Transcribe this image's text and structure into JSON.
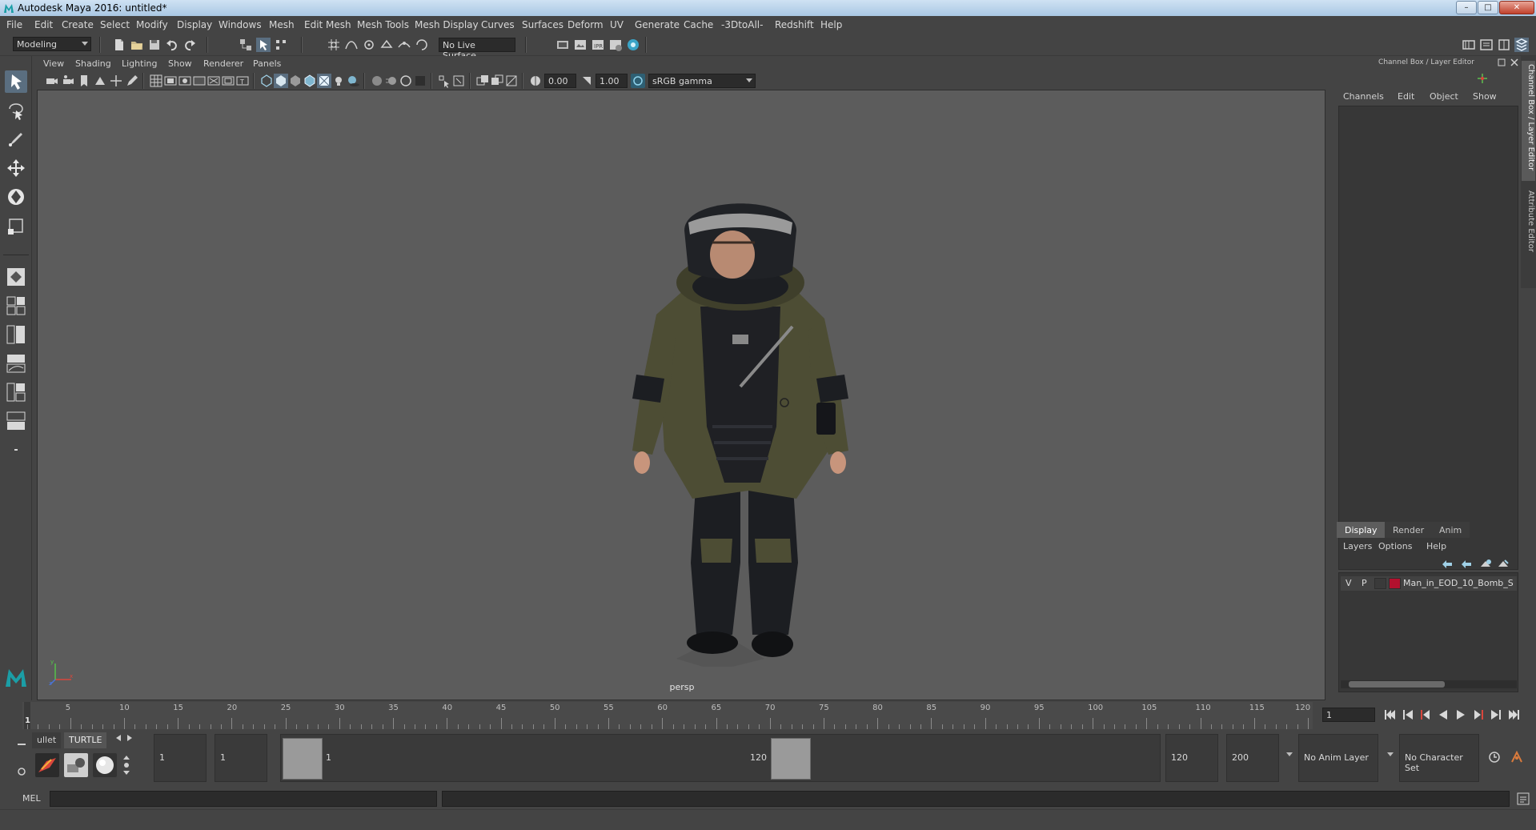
{
  "window": {
    "title": "Autodesk Maya 2016: untitled*",
    "controls": {
      "minimize": "–",
      "maximize": "□",
      "close": "✕"
    }
  },
  "menubar": {
    "items": [
      "File",
      "Edit",
      "Create",
      "Select",
      "Modify",
      "Display",
      "Windows",
      "Mesh",
      "Edit Mesh",
      "Mesh Tools",
      "Mesh Display",
      "Curves",
      "Surfaces",
      "Deform",
      "UV",
      "Generate",
      "Cache",
      "-3DtoAll-",
      "Redshift",
      "Help"
    ]
  },
  "statusline": {
    "menuset": "Modeling",
    "live_surface": "No Live Surface"
  },
  "panel": {
    "menus": [
      "View",
      "Shading",
      "Lighting",
      "Show",
      "Renderer",
      "Panels"
    ],
    "exposure": "0.00",
    "gamma": "1.00",
    "color_space": "sRGB gamma",
    "camera": "persp"
  },
  "channel_box": {
    "header": "Channel Box / Layer Editor",
    "menus": [
      "Channels",
      "Edit",
      "Object",
      "Show"
    ]
  },
  "layer_editor": {
    "tabs": [
      "Display",
      "Render",
      "Anim"
    ],
    "active_tab": "Display",
    "menus": [
      "Layers",
      "Options",
      "Help"
    ],
    "layer": {
      "visible": "V",
      "playback": "P",
      "color": "#b3112e",
      "name": "Man_in_EOD_10_Bomb_S"
    }
  },
  "side_tabs": [
    "Channel Box / Layer Editor",
    "Attribute Editor"
  ],
  "timeline": {
    "ticks": [
      5,
      10,
      15,
      20,
      25,
      30,
      35,
      40,
      45,
      50,
      55,
      60,
      65,
      70,
      75,
      80,
      85,
      90,
      95,
      100,
      105,
      110,
      115,
      120
    ],
    "current_frame": "1",
    "current_frame_field": "1",
    "min": 1,
    "max": 120
  },
  "shelf": {
    "tabs": [
      "ullet",
      "TURTLE"
    ],
    "active_tab": "TURTLE"
  },
  "range": {
    "start_time": "1",
    "playback_start": "1",
    "slider_start": "1",
    "slider_end": "120",
    "playback_end": "120",
    "end_time": "200",
    "anim_layer": "No Anim Layer",
    "character_set": "No Character Set"
  },
  "command_line": {
    "label": "MEL"
  },
  "colors": {
    "viewport_bg": "#5c5c5c",
    "ui_bg": "#444444",
    "accent": "#5a6e80",
    "suit_olive": "#4d4d34"
  }
}
